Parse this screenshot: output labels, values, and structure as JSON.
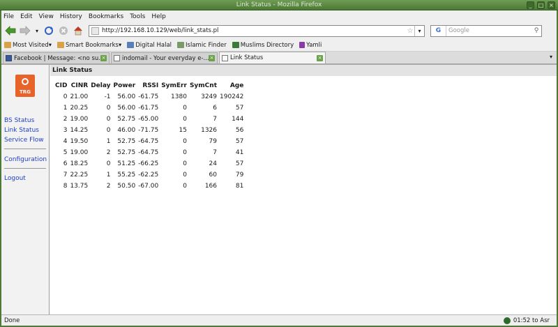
{
  "window": {
    "title": "Link Status - Mozilla Firefox"
  },
  "menu": [
    "File",
    "Edit",
    "View",
    "History",
    "Bookmarks",
    "Tools",
    "Help"
  ],
  "navigation": {
    "url": "http://192.168.10.129/web/link_stats.pl",
    "search_placeholder": "Google",
    "search_engine_icon": "G"
  },
  "bookmarks": [
    {
      "label": "Most Visited",
      "color": "#c0692a"
    },
    {
      "label": "Smart Bookmarks",
      "color": "#c0692a"
    },
    {
      "label": "Digital Halal",
      "color": "#5a7fb8"
    },
    {
      "label": "Islamic Finder",
      "color": "#7a9a6a"
    },
    {
      "label": "Muslims Directory",
      "color": "#3c7a3c"
    },
    {
      "label": "Yamli",
      "color": "#8a3aa8"
    }
  ],
  "tabs": [
    {
      "label": "Facebook | Message: <no su...",
      "active": false
    },
    {
      "label": "indomail - Your everyday e-...",
      "active": false
    },
    {
      "label": "Link Status",
      "active": true
    }
  ],
  "sidebar": {
    "logo_text": "TRG",
    "links": [
      "BS Status",
      "Link Status",
      "Service Flow",
      "Configuration",
      "Logout"
    ]
  },
  "page": {
    "heading": "Link Status",
    "table": {
      "columns": [
        "CID",
        "CINR",
        "Delay",
        "Power",
        "RSSI",
        "SymErr",
        "SymCnt",
        "Age"
      ],
      "rows": [
        [
          "0",
          "21.00",
          "-1",
          "56.00",
          "-61.75",
          "1380",
          "3249",
          "190242"
        ],
        [
          "1",
          "20.25",
          "0",
          "56.00",
          "-61.75",
          "0",
          "6",
          "57"
        ],
        [
          "2",
          "19.00",
          "0",
          "52.75",
          "-65.00",
          "0",
          "7",
          "144"
        ],
        [
          "3",
          "14.25",
          "0",
          "46.00",
          "-71.75",
          "15",
          "1326",
          "56"
        ],
        [
          "4",
          "19.50",
          "1",
          "52.75",
          "-64.75",
          "0",
          "79",
          "57"
        ],
        [
          "5",
          "19.00",
          "2",
          "52.75",
          "-64.75",
          "0",
          "7",
          "41"
        ],
        [
          "6",
          "18.25",
          "0",
          "51.25",
          "-66.25",
          "0",
          "24",
          "57"
        ],
        [
          "7",
          "22.25",
          "1",
          "55.25",
          "-62.25",
          "0",
          "60",
          "79"
        ],
        [
          "8",
          "13.75",
          "2",
          "50.50",
          "-67.00",
          "0",
          "166",
          "81"
        ]
      ]
    }
  },
  "status": {
    "text": "Done",
    "prayer_time": "01:52 to Asr"
  }
}
